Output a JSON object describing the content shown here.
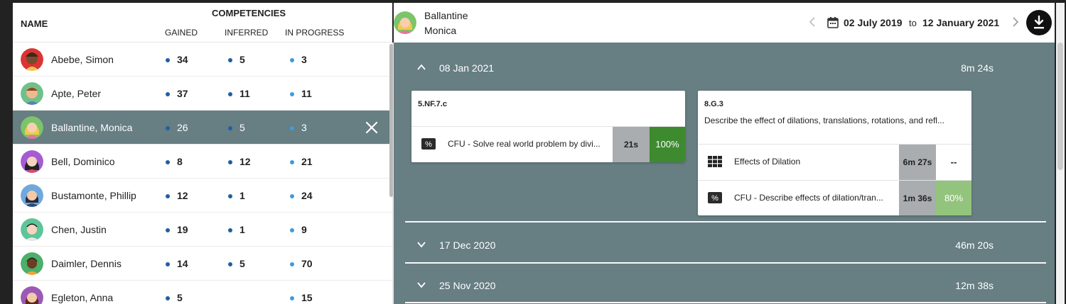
{
  "students_header": {
    "name_col": "NAME",
    "competencies": "COMPETENCIES",
    "gained": "GAINED",
    "inferred": "INFERRED",
    "in_progress": "IN PROGRESS"
  },
  "colors": {
    "dot_gained": "#1f5fa6",
    "dot_inferred": "#1f5fa6",
    "dot_in_progress": "#3d9be0",
    "selected_row": "#677e83",
    "score_full": "#3d8a2f",
    "score_partial": "#93c47d"
  },
  "students": [
    {
      "name": "Abebe, Simon",
      "gained": "34",
      "inferred": "5",
      "in_progress": "3"
    },
    {
      "name": "Apte, Peter",
      "gained": "37",
      "inferred": "11",
      "in_progress": "11"
    },
    {
      "name": "Ballantine, Monica",
      "gained": "26",
      "inferred": "5",
      "in_progress": "3",
      "selected": true
    },
    {
      "name": "Bell, Dominico",
      "gained": "8",
      "inferred": "12",
      "in_progress": "21"
    },
    {
      "name": "Bustamonte, Phillip",
      "gained": "12",
      "inferred": "1",
      "in_progress": "24"
    },
    {
      "name": "Chen, Justin",
      "gained": "19",
      "inferred": "1",
      "in_progress": "9"
    },
    {
      "name": "Daimler, Dennis",
      "gained": "14",
      "inferred": "5",
      "in_progress": "70"
    },
    {
      "name": "Egleton, Anna",
      "gained": "5",
      "inferred": "",
      "in_progress": "15"
    }
  ],
  "detail": {
    "last_name": "Ballantine",
    "first_name": "Monica",
    "date_from": "02 July 2019",
    "to_word": "to",
    "date_to": "12 January 2021",
    "sessions": [
      {
        "date": "08 Jan 2021",
        "duration": "8m 24s",
        "expanded": true
      },
      {
        "date": "17 Dec 2020",
        "duration": "46m 20s",
        "expanded": false
      },
      {
        "date": "25 Nov 2020",
        "duration": "12m 38s",
        "expanded": false
      }
    ],
    "cards": [
      {
        "code": "5.NF.7.c",
        "description": "",
        "activities": [
          {
            "icon": "percent-icon",
            "label": "CFU - Solve real world problem by divi...",
            "time": "21s",
            "score": "100%"
          }
        ]
      },
      {
        "code": "8.G.3",
        "description": "Describe the effect of dilations, translations, rotations, and refl...",
        "activities": [
          {
            "icon": "grid-icon",
            "label": "Effects of Dilation",
            "time": "6m 27s",
            "score": "--"
          },
          {
            "icon": "percent-icon",
            "label": "CFU - Describe effects of dilation/tran...",
            "time": "1m 36s",
            "score": "80%"
          }
        ]
      }
    ]
  }
}
